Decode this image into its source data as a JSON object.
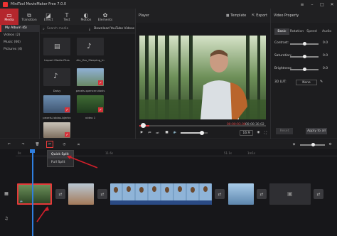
{
  "app": {
    "title": "MiniTool MovieMaker Free 7.0.0"
  },
  "nav": {
    "items": [
      {
        "label": "Media",
        "icon": "folder-icon"
      },
      {
        "label": "Transition",
        "icon": "transition-icon"
      },
      {
        "label": "Effect",
        "icon": "effect-icon"
      },
      {
        "label": "Text",
        "icon": "text-icon"
      },
      {
        "label": "Motion",
        "icon": "motion-icon"
      },
      {
        "label": "Elements",
        "icon": "elements-icon"
      }
    ]
  },
  "library": {
    "items": [
      "My Album (6)",
      "Videos (2)",
      "Music (66)",
      "Pictures (4)"
    ]
  },
  "media": {
    "search_placeholder": "Search media",
    "download_label": "Download YouTube Videos",
    "import_label": "Import Media Files",
    "items": [
      "Ain_You_Sleeping_In",
      "Daisy",
      "pexels-spencer-davis",
      "pexels-tobias-bjerkn",
      "video 1"
    ]
  },
  "player": {
    "title": "Player",
    "template_label": "Template",
    "export_label": "Export",
    "time_current": "00:00:03.00",
    "time_total": "00:00:30.02",
    "aspect": "16:9",
    "progress": 0.08,
    "volume": 0.75
  },
  "props": {
    "title": "Video Property",
    "tabs": [
      "Basic",
      "Rotation",
      "Speed",
      "Audio"
    ],
    "sliders": [
      {
        "label": "Contrast:",
        "value": "0.0"
      },
      {
        "label": "Saturation:",
        "value": "0.0"
      },
      {
        "label": "Brightness:",
        "value": "0.0"
      }
    ],
    "lut_label": "3D LUT:",
    "lut_value": "None",
    "reset_label": "Reset",
    "apply_label": "Apply to all"
  },
  "timeline": {
    "menu": [
      "Quick Split",
      "Full Split"
    ],
    "ruler": [
      "0s",
      "11.6s",
      "51.1s",
      "1m1s"
    ]
  },
  "colors": {
    "accent": "#d3323a",
    "playhead": "#2f7fe0",
    "selection": "#e43a3a"
  }
}
